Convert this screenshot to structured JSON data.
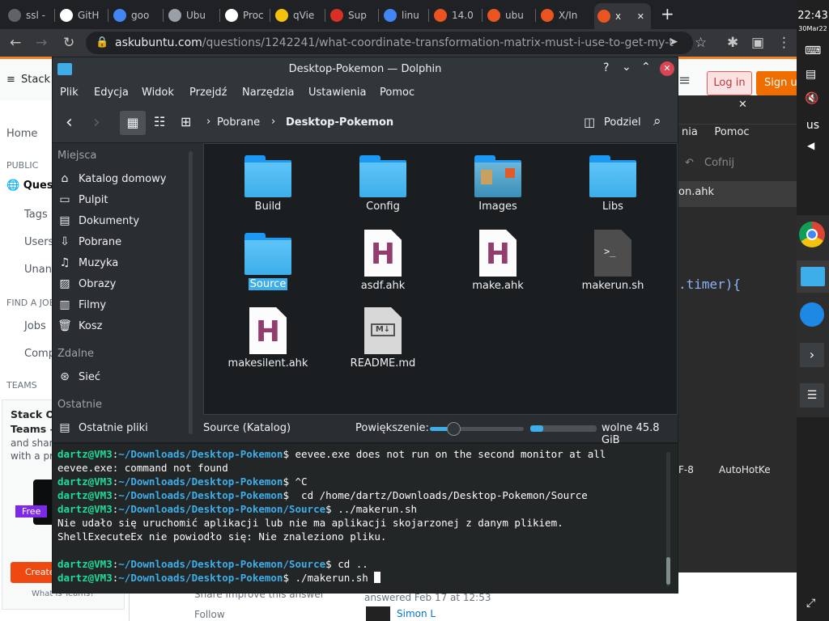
{
  "browser": {
    "tabs": [
      {
        "label": "ssl -",
        "icon": "tab-icon-generic",
        "color": "#5f6368"
      },
      {
        "label": "GitH",
        "icon": "github-icon",
        "color": "#ffffff"
      },
      {
        "label": "goo",
        "icon": "google-icon",
        "color": "#4285f4"
      },
      {
        "label": "Ubu",
        "icon": "globe-icon",
        "color": "#9aa0a6"
      },
      {
        "label": "Proc",
        "icon": "letter-a-icon",
        "color": "#ffffff"
      },
      {
        "label": "qVie",
        "icon": "qview-icon",
        "color": "#f4c20d"
      },
      {
        "label": "Sup",
        "icon": "shield-icon",
        "color": "#d93025"
      },
      {
        "label": "linu",
        "icon": "google-icon",
        "color": "#4285f4"
      },
      {
        "label": "14.0",
        "icon": "askubuntu-icon",
        "color": "#e95420"
      },
      {
        "label": "ubu",
        "icon": "askubuntu-icon",
        "color": "#e95420"
      },
      {
        "label": "X/In",
        "icon": "ubuntu-icon",
        "color": "#e95420"
      },
      {
        "label": "x",
        "icon": "askubuntu-icon",
        "color": "#e95420"
      }
    ],
    "url_host": "askubuntu.com",
    "url_path": "/questions/1242241/what-coordinate-transformation-matrix-must-i-use-to-get-my-t..."
  },
  "webpage": {
    "logo_text": "Stack",
    "login": "Log in",
    "signup": "Sign u",
    "nav": [
      "Home",
      "Tags",
      "Users",
      "Unans",
      "Jobs",
      "Comp"
    ],
    "public": "PUBLIC",
    "questions": "Quest",
    "find_job": "FIND A JOB",
    "teams": "TEAMS",
    "teams_title": "Stack Ov",
    "teams_title2": "Teams –",
    "teams_body1": "and shar",
    "teams_body2": "with a pri",
    "free_badge": "Free",
    "create": "Create",
    "what_is_teams": "What is Teams?",
    "share": "Share  Improve this answer",
    "follow": "Follow",
    "answered": "answered Feb 17 at 12:53",
    "user": "Simon L",
    "editor_menu": "nia     Pomoc",
    "editor_undo": "Cofnij",
    "editor_tab": "on.ahk",
    "editor_code": ".timer){",
    "editor_enc": "F-8",
    "editor_lang": "AutoHotKe"
  },
  "dolphin": {
    "title": "Desktop-Pokemon — Dolphin",
    "menu": [
      "Plik",
      "Edycja",
      "Widok",
      "Przejdź",
      "Narzędzia",
      "Ustawienia",
      "Pomoc"
    ],
    "breadcrumb": [
      "Pobrane",
      "Desktop-Pokemon"
    ],
    "split_label": "Podziel",
    "places_heading": "Miejsca",
    "places": [
      {
        "label": "Katalog domowy",
        "icon": "home-icon"
      },
      {
        "label": "Pulpit",
        "icon": "desktop-icon"
      },
      {
        "label": "Dokumenty",
        "icon": "documents-icon"
      },
      {
        "label": "Pobrane",
        "icon": "download-icon"
      },
      {
        "label": "Muzyka",
        "icon": "music-icon"
      },
      {
        "label": "Obrazy",
        "icon": "images-icon"
      },
      {
        "label": "Filmy",
        "icon": "video-icon"
      },
      {
        "label": "Kosz",
        "icon": "trash-icon"
      }
    ],
    "remote_heading": "Zdalne",
    "remote": [
      {
        "label": "Sieć",
        "icon": "network-icon"
      }
    ],
    "recent_heading": "Ostatnie",
    "recent": [
      {
        "label": "Ostatnie pliki",
        "icon": "recent-files-icon"
      }
    ],
    "files": [
      {
        "name": "Build",
        "type": "folder"
      },
      {
        "name": "Config",
        "type": "folder"
      },
      {
        "name": "Images",
        "type": "folder-images"
      },
      {
        "name": "Libs",
        "type": "folder"
      },
      {
        "name": "Source",
        "type": "folder",
        "selected": true
      },
      {
        "name": "asdf.ahk",
        "type": "ahk"
      },
      {
        "name": "make.ahk",
        "type": "ahk"
      },
      {
        "name": "makerun.sh",
        "type": "shell"
      },
      {
        "name": "makesilent.ahk",
        "type": "ahk"
      },
      {
        "name": "README.md",
        "type": "markdown"
      }
    ],
    "status": "Source (Katalog)",
    "zoom_label": "Powiększenie:",
    "zoom_level": 0.25,
    "disk_used": 0.2,
    "free_space": "wolne 45.8 GiB"
  },
  "terminal": {
    "lines": [
      {
        "user": "dartz@VM3",
        "path": "~/Downloads/Desktop-Pokemon",
        "cmd": "$ eevee.exe does not run on the second monitor at all"
      },
      {
        "text": "eevee.exe: command not found"
      },
      {
        "user": "dartz@VM3",
        "path": "~/Downloads/Desktop-Pokemon",
        "cmd": "$ ^C"
      },
      {
        "user": "dartz@VM3",
        "path": "~/Downloads/Desktop-Pokemon",
        "cmd": "$  cd /home/dartz/Downloads/Desktop-Pokemon/Source"
      },
      {
        "user": "dartz@VM3",
        "path": "~/Downloads/Desktop-Pokemon/Source",
        "cmd": "$ ../makerun.sh"
      },
      {
        "text": "Nie udało się uruchomić aplikacji lub nie ma aplikacji skojarzonej z danym plikiem."
      },
      {
        "text": "ShellExecuteEx nie powiodło się: Nie znaleziono pliku."
      },
      {
        "text": ""
      },
      {
        "user": "dartz@VM3",
        "path": "~/Downloads/Desktop-Pokemon/Source",
        "cmd": "$ cd .."
      },
      {
        "user": "dartz@VM3",
        "path": "~/Downloads/Desktop-Pokemon",
        "cmd": "$ ./makerun.sh "
      }
    ]
  },
  "system": {
    "time": "22:43",
    "date": "30Mar22",
    "keyboard_layout": "us"
  },
  "colors": {
    "accent": "#3daee9",
    "folder": "#3daee9",
    "prompt_user": "#1cdc9a",
    "prompt_path": "#3daee9"
  }
}
